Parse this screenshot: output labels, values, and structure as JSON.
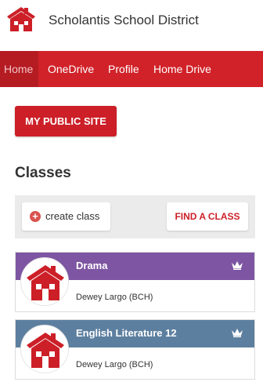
{
  "header": {
    "district_name": "Scholantis School District",
    "logo_icon": "schoolhouse-icon"
  },
  "nav": {
    "items": [
      {
        "label": "Home",
        "active": true
      },
      {
        "label": "OneDrive",
        "active": false
      },
      {
        "label": "Profile",
        "active": false
      },
      {
        "label": "Home Drive",
        "active": false
      }
    ]
  },
  "public_site_button": "MY PUBLIC SITE",
  "classes": {
    "title": "Classes",
    "create_label": "create class",
    "create_icon": "plus-circle-icon",
    "find_label": "FIND A CLASS",
    "list": [
      {
        "name": "Drama",
        "teacher": "Dewey Largo (BCH)",
        "color": "#7d55a2",
        "badge_icon": "crown-icon"
      },
      {
        "name": "English Literature 12",
        "teacher": "Dewey Largo (BCH)",
        "color": "#5d7f9f",
        "badge_icon": "crown-icon"
      }
    ]
  },
  "colors": {
    "brand_red": "#d12229",
    "nav_active": "#b51c22"
  }
}
